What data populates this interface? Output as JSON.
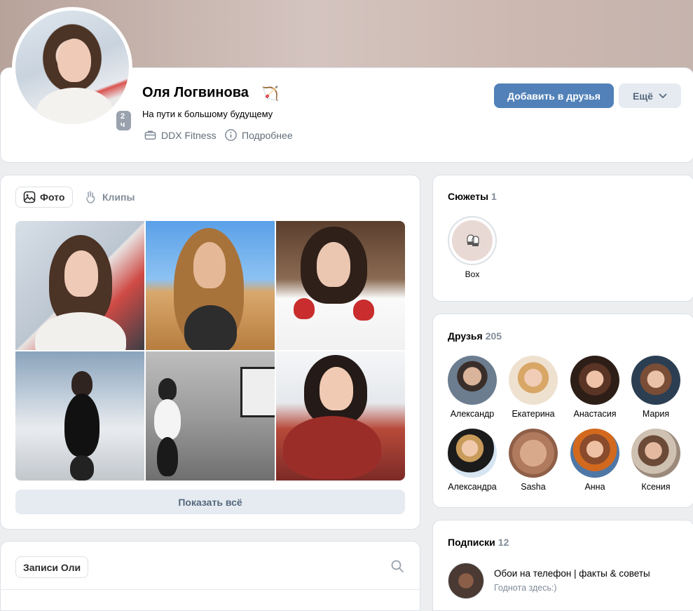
{
  "profile": {
    "name": "Оля Логвинова",
    "name_emoji": "🏹",
    "status": "На пути к большому будущему",
    "online_badge": "2 ч",
    "work": "DDX Fitness",
    "details": "Подробнее",
    "add_friend": "Добавить в друзья",
    "more": "Ещё"
  },
  "photos": {
    "tab_photos": "Фото",
    "tab_clips": "Клипы",
    "show_all": "Показать всё"
  },
  "wall": {
    "tab": "Записи Оли"
  },
  "stories": {
    "title": "Сюжеты",
    "count": "1",
    "items": [
      {
        "label": "Box"
      }
    ]
  },
  "friends": {
    "title": "Друзья",
    "count": "205",
    "items": [
      {
        "name": "Александр",
        "color": "#6b7d8f"
      },
      {
        "name": "Екатерина",
        "color": "#e4c7a6"
      },
      {
        "name": "Анастасия",
        "color": "#8a5a45"
      },
      {
        "name": "Мария",
        "color": "#4a6a85"
      },
      {
        "name": "Александра",
        "color": "#c9d9ea"
      },
      {
        "name": "Sasha",
        "color": "#b58a72"
      },
      {
        "name": "Анна",
        "color": "#5a7fa3"
      },
      {
        "name": "Ксения",
        "color": "#b9a493"
      }
    ]
  },
  "subscriptions": {
    "title": "Подписки",
    "count": "12",
    "items": [
      {
        "title": "Обои на телефон | факты & советы",
        "desc": "Годнота здесь:)"
      }
    ]
  },
  "colors": {
    "accent": "#5181b8",
    "secondary_bg": "#e5ebf1",
    "page_bg": "#edeef0"
  }
}
